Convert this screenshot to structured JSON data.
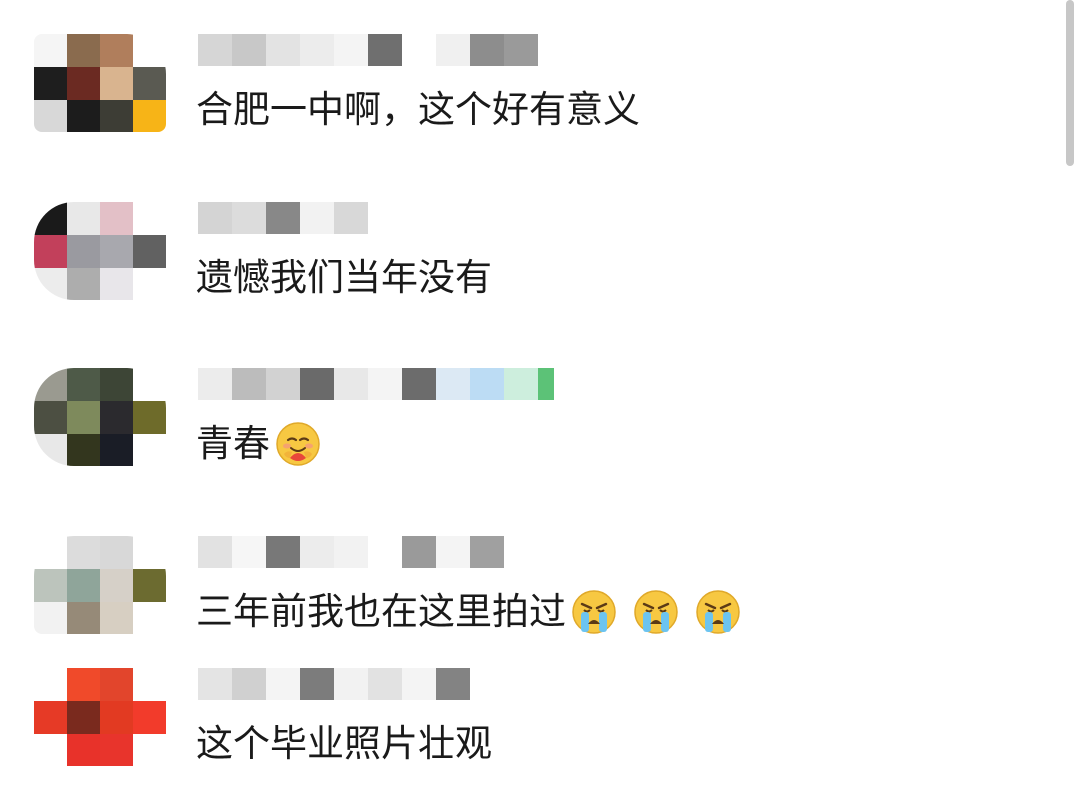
{
  "comments": [
    {
      "text": "合肥一中啊，这个好有意义",
      "emojis": []
    },
    {
      "text": "遗憾我们当年没有",
      "emojis": []
    },
    {
      "text": "青春",
      "emojis": [
        "hugging-face-icon"
      ]
    },
    {
      "text": "三年前我也在这里拍过",
      "emojis": [
        "loudly-crying-face-icon",
        "loudly-crying-face-icon",
        "loudly-crying-face-icon"
      ]
    },
    {
      "text": "这个毕业照片壮观",
      "emojis": []
    }
  ],
  "colors": {
    "text": "#1a1a1a",
    "scrollbar": "#c7c7c7",
    "emoji_face": "#f7c842"
  }
}
